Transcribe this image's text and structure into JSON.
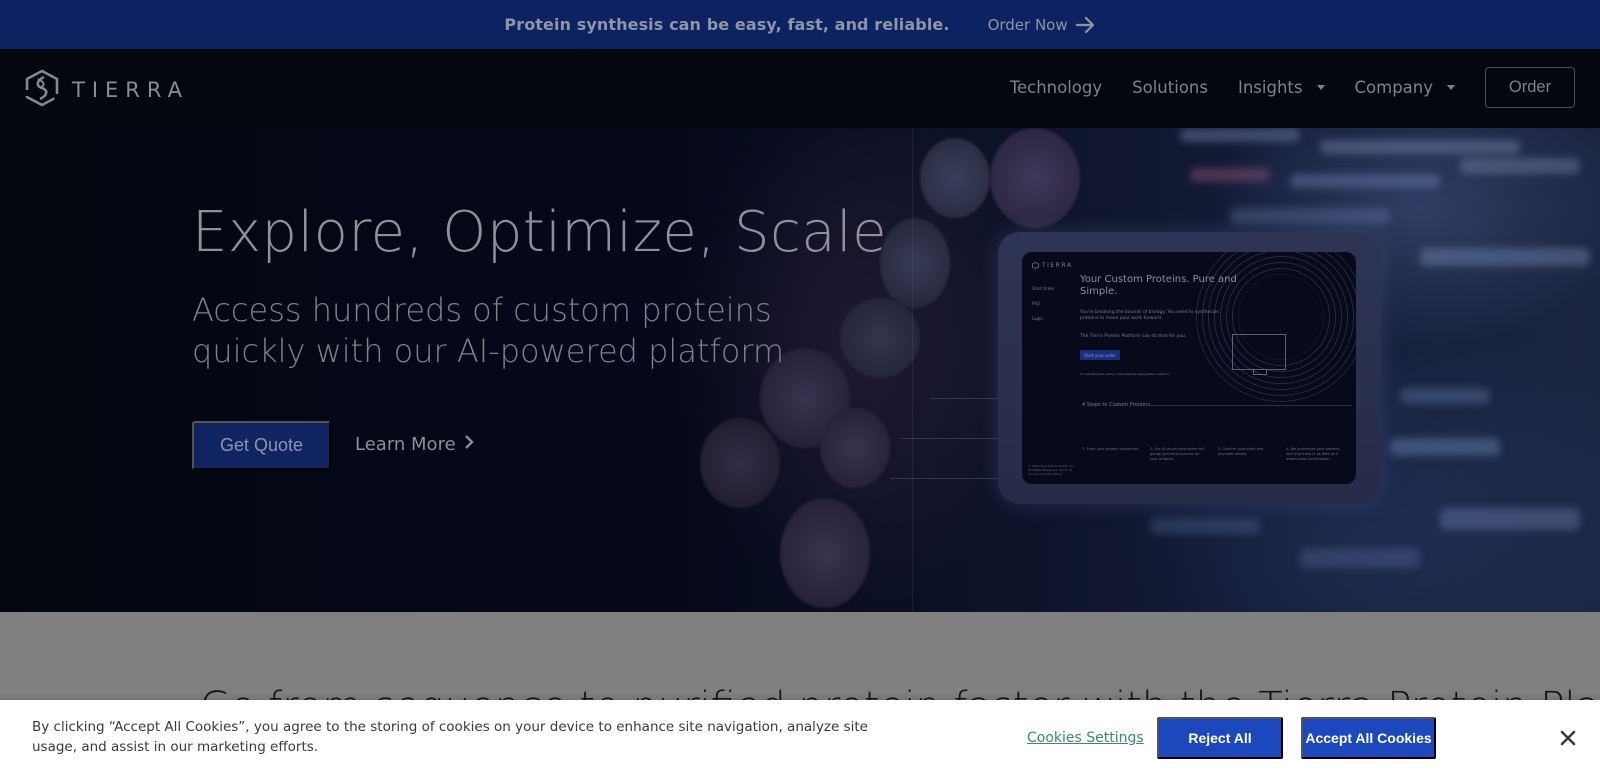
{
  "announcement": {
    "message": "Protein synthesis can be easy, fast, and reliable.",
    "link_label": "Order Now",
    "link_icon": "arrow-right-icon"
  },
  "nav": {
    "logo_text": "TIERRA",
    "logo_icon": "tierra-hexagon-logo-icon",
    "links": [
      {
        "label": "Technology",
        "has_dropdown": false
      },
      {
        "label": "Solutions",
        "has_dropdown": false
      },
      {
        "label": "Insights",
        "has_dropdown": true
      },
      {
        "label": "Company",
        "has_dropdown": true
      }
    ],
    "order_label": "Order"
  },
  "hero": {
    "title": "Explore, Optimize, Scale",
    "subtitle": "Access hundreds of custom proteins quickly with our AI-powered platform",
    "primary_button": "Get Quote",
    "secondary_link": "Learn More",
    "secondary_icon": "chevron-right-icon",
    "mockup": {
      "logo_text": "TIERRA",
      "side_links": [
        "Start Order",
        "FAQ",
        "Login"
      ],
      "heading": "Your Custom Proteins. Pure and Simple.",
      "para1": "You're breaking the bounds of biology. You need to synthesize proteins to move your work forward.",
      "para2": "The Tierra Protein Platform can do that for you.",
      "button": "Start your order",
      "note": "For enterprise size orders or other business needs please contact us.",
      "steps_title": "4 Steps to Custom Proteins",
      "steps": [
        "1. Enter your protein sequences.",
        "2. Our AI-driven evaluation will gauge synthesis success for your proteins.",
        "3. Confirm your order and payment details.",
        "4. We synthesize your proteins and ship them in as little as 3 weeks from confirmation."
      ],
      "footer": "© 2022 Tierra Biosciences, Inc. All Rights Reserved. Terms of Service | Privacy Policy"
    }
  },
  "section": {
    "heading": "Go from sequence to purified protein faster with the Tierra Protein Platform"
  },
  "cookie_banner": {
    "text": "By clicking “Accept All Cookies”, you agree to the storing of cookies on your device to enhance site navigation, analyze site usage, and assist in our marketing efforts.",
    "settings_label": "Cookies Settings",
    "reject_label": "Reject All",
    "accept_label": "Accept All Cookies",
    "close_icon": "close-icon"
  },
  "colors": {
    "announcement_bg": "#0d2260",
    "nav_bg": "#03050f",
    "primary_button": "#0f2461",
    "cookie_button": "#1d48bd",
    "cookie_link": "#3b8a6f",
    "overlay_grey": "#808080"
  }
}
